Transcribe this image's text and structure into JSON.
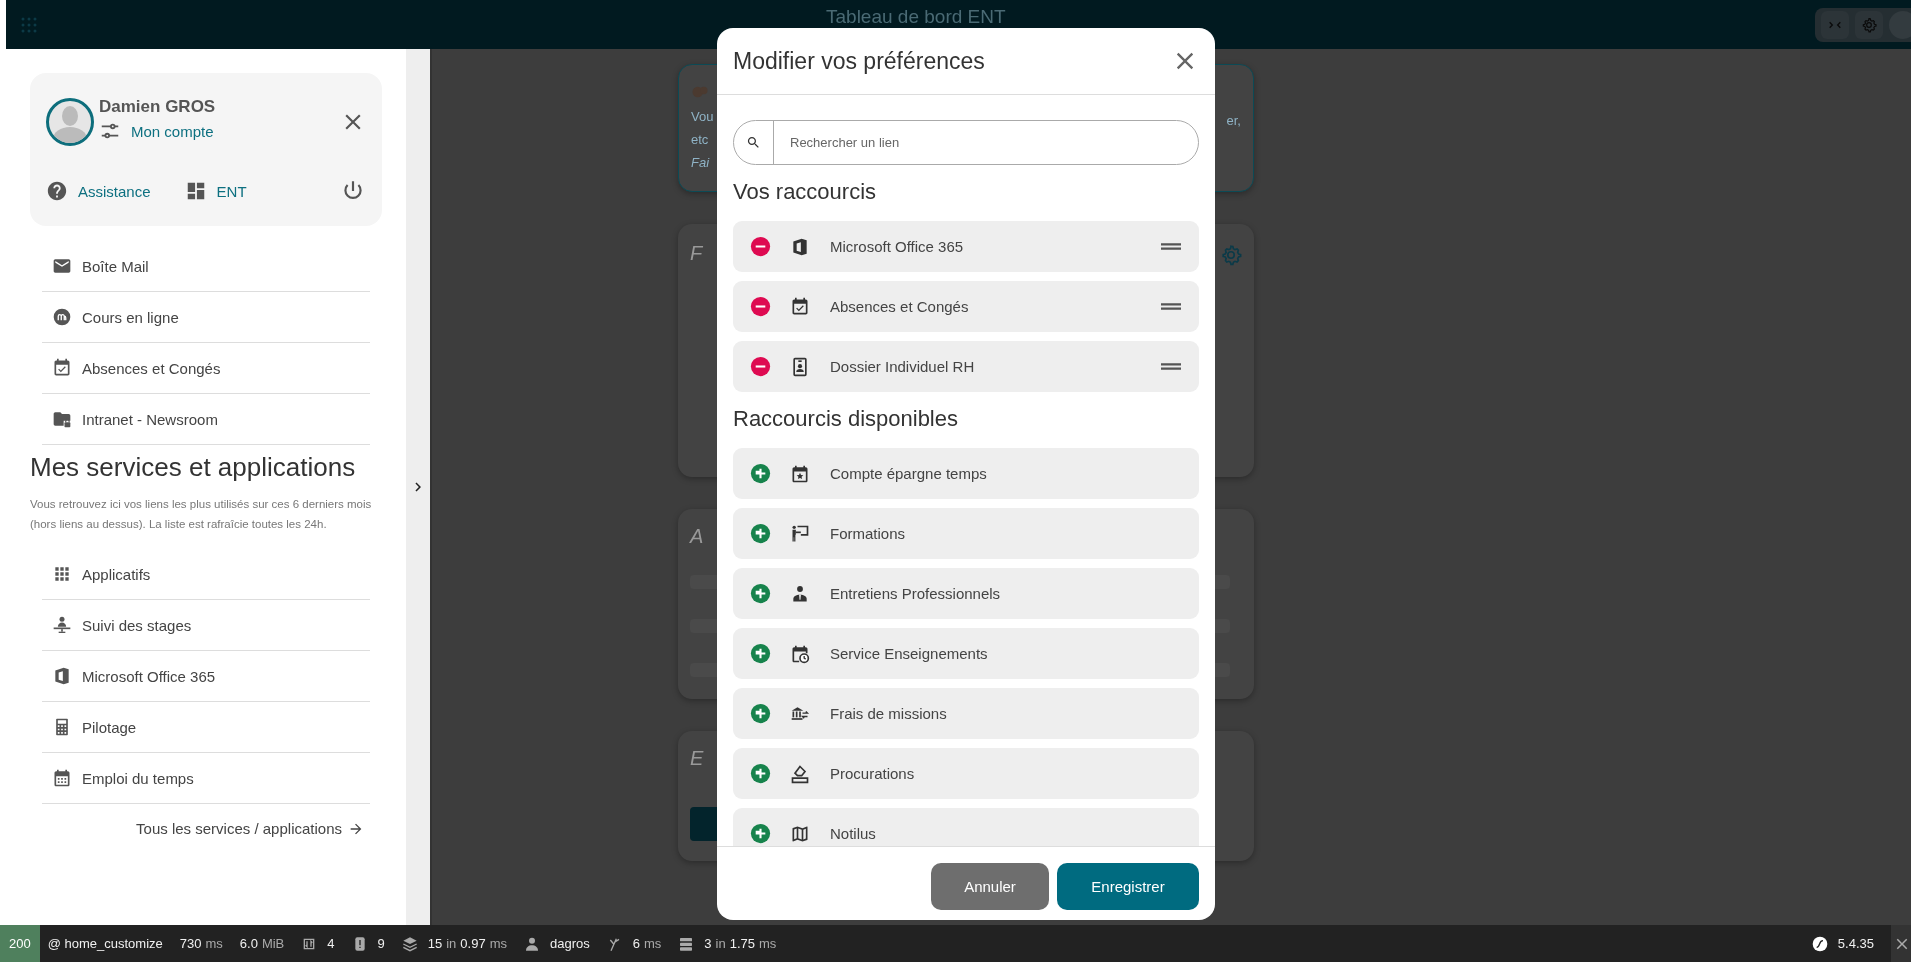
{
  "header": {
    "title": "Tableau de bord ENT"
  },
  "user_card": {
    "name": "Damien GROS",
    "account_link": "Mon compte",
    "links": [
      {
        "label": "Assistance"
      },
      {
        "label": "ENT"
      }
    ]
  },
  "pinned_links": [
    {
      "label": "Boîte Mail"
    },
    {
      "label": "Cours en ligne"
    },
    {
      "label": "Absences et Congés"
    },
    {
      "label": "Intranet - Newsroom"
    }
  ],
  "services": {
    "title": "Mes services et applications",
    "description": "Vous retrouvez ici vos liens les plus utilisés sur ces 6 derniers mois (hors liens au dessus). La liste est rafraîcie toutes les 24h.",
    "items": [
      {
        "label": "Applicatifs"
      },
      {
        "label": "Suivi des stages"
      },
      {
        "label": "Microsoft Office 365"
      },
      {
        "label": "Pilotage"
      },
      {
        "label": "Emploi du temps"
      }
    ],
    "all_link": "Tous les services / applications"
  },
  "background_cards": [
    {
      "left_lines": [
        {
          "text": "Vou",
          "italic": false
        },
        {
          "text": "etc",
          "italic": false
        },
        {
          "text": "Fai",
          "italic": true
        }
      ],
      "right_text": "er,"
    },
    {
      "heading": "F"
    },
    {
      "heading": "A"
    },
    {
      "heading": "E"
    }
  ],
  "modal": {
    "title": "Modifier vos préférences",
    "search": {
      "placeholder": "Rechercher un lien"
    },
    "sections": [
      {
        "title": "Vos raccourcis",
        "items": [
          {
            "label": "Microsoft Office 365",
            "kind": "remove"
          },
          {
            "label": "Absences et Congés",
            "kind": "remove"
          },
          {
            "label": "Dossier Individuel RH",
            "kind": "remove"
          }
        ]
      },
      {
        "title": "Raccourcis disponibles",
        "items": [
          {
            "label": "Compte épargne temps",
            "kind": "add"
          },
          {
            "label": "Formations",
            "kind": "add"
          },
          {
            "label": "Entretiens Professionnels",
            "kind": "add"
          },
          {
            "label": "Service Enseignements",
            "kind": "add"
          },
          {
            "label": "Frais de missions",
            "kind": "add"
          },
          {
            "label": "Procurations",
            "kind": "add"
          },
          {
            "label": "Notilus",
            "kind": "add"
          }
        ]
      }
    ],
    "buttons": [
      {
        "label": "Annuler",
        "kind": "secondary"
      },
      {
        "label": "Enregistrer",
        "kind": "primary"
      }
    ]
  },
  "status_bar": {
    "status": "200",
    "items": [
      {
        "parts": [
          {
            "text": "@ home_customize",
            "dim": false
          }
        ]
      },
      {
        "parts": [
          {
            "text": "730",
            "dim": false
          },
          {
            "text": "ms",
            "dim": true
          }
        ]
      },
      {
        "parts": [
          {
            "text": "6.0",
            "dim": false
          },
          {
            "text": "MiB",
            "dim": true
          }
        ]
      },
      {
        "parts": [
          {
            "text": "4",
            "dim": false
          }
        ]
      },
      {
        "parts": [
          {
            "text": "9",
            "dim": false
          }
        ]
      },
      {
        "parts": [
          {
            "text": "15",
            "dim": false
          },
          {
            "text": "in",
            "dim": true
          },
          {
            "text": "0.97",
            "dim": false
          },
          {
            "text": "ms",
            "dim": true
          }
        ]
      },
      {
        "parts": [
          {
            "text": "dagros",
            "dim": false
          }
        ]
      },
      {
        "parts": [
          {
            "text": "6",
            "dim": false
          },
          {
            "text": "ms",
            "dim": true
          }
        ]
      },
      {
        "parts": [
          {
            "text": "3",
            "dim": false
          },
          {
            "text": "in",
            "dim": true
          },
          {
            "text": "1.75",
            "dim": false
          },
          {
            "text": "ms",
            "dim": true
          }
        ]
      }
    ],
    "version": "5.4.35"
  }
}
